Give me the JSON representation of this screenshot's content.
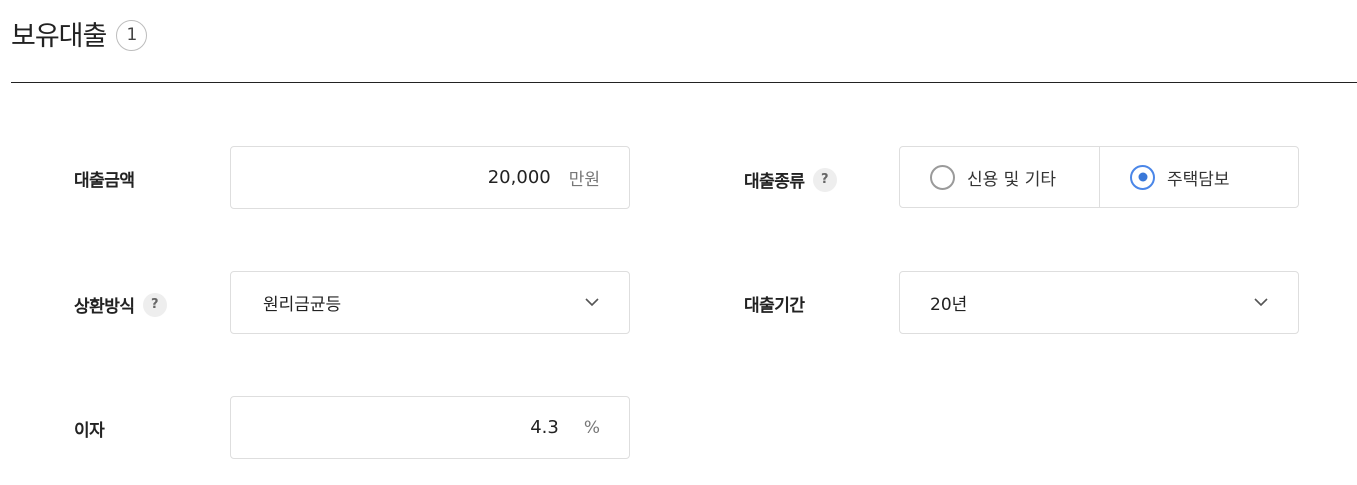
{
  "header": {
    "title": "보유대출",
    "count": "1"
  },
  "loan_amount": {
    "label": "대출금액",
    "value": "20,000",
    "unit": "만원"
  },
  "loan_type": {
    "label": "대출종류",
    "help": "?",
    "options": [
      {
        "label": "신용 및 기타",
        "selected": false
      },
      {
        "label": "주택담보",
        "selected": true
      }
    ]
  },
  "repayment": {
    "label": "상환방식",
    "help": "?",
    "selected": "원리금균등"
  },
  "loan_period": {
    "label": "대출기간",
    "selected": "20년"
  },
  "interest": {
    "label": "이자",
    "value": "4.3",
    "unit": "%"
  },
  "colors": {
    "accent": "#3a78d8",
    "border": "#dedede",
    "divider": "#222222"
  },
  "icons": {
    "help": "question-icon",
    "dropdown": "chevron-down-icon"
  }
}
